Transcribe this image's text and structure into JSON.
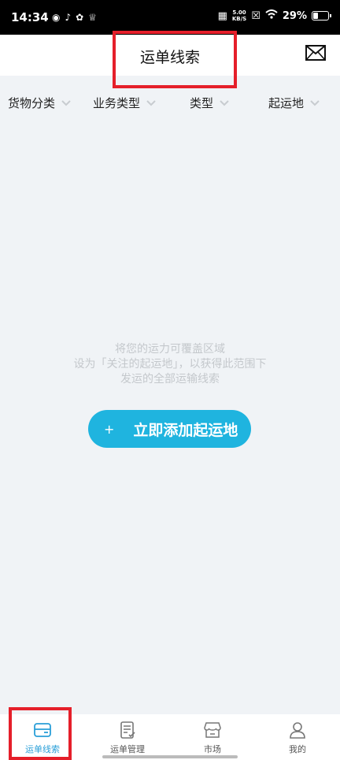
{
  "status_bar": {
    "time": "14:34",
    "net_speed_value": "5.00",
    "net_speed_unit": "KB/S",
    "battery": "29%"
  },
  "header": {
    "title": "运单线索"
  },
  "filters": [
    {
      "label": "货物分类"
    },
    {
      "label": "业务类型"
    },
    {
      "label": "类型"
    },
    {
      "label": "起运地"
    }
  ],
  "empty_state": {
    "line1": "将您的运力可覆盖区域",
    "line2": "设为「关注的起运地」，以获得此范围下",
    "line3": "发运的全部运输线索"
  },
  "add_button": {
    "plus": "+",
    "label": "立即添加起运地"
  },
  "tabs": [
    {
      "label": "运单线索",
      "icon": "box-icon",
      "active": true
    },
    {
      "label": "运单管理",
      "icon": "document-icon",
      "active": false
    },
    {
      "label": "市场",
      "icon": "store-icon",
      "active": false
    },
    {
      "label": "我的",
      "icon": "user-icon",
      "active": false
    }
  ],
  "colors": {
    "accent": "#1fb4df",
    "tab_active": "#2a9fd8",
    "highlight": "#e51f2a",
    "background": "#f0f3f6"
  }
}
